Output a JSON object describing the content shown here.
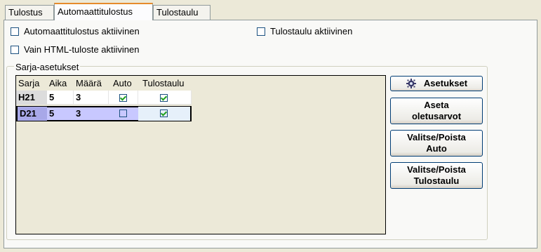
{
  "tabs": [
    {
      "label": "Tulostus",
      "active": false
    },
    {
      "label": "Automaattitulostus",
      "active": true
    },
    {
      "label": "Tulostaulu",
      "active": false
    }
  ],
  "options": {
    "auto_active_label": "Automaattitulostus aktiivinen",
    "auto_active_checked": false,
    "board_active_label": "Tulostaulu aktiivinen",
    "board_active_checked": false,
    "html_only_label": "Vain HTML-tuloste aktiivinen",
    "html_only_checked": false
  },
  "series_group": {
    "title": "Sarja-asetukset",
    "columns": [
      "Sarja",
      "Aika",
      "Määrä",
      "Auto",
      "Tulostaulu"
    ],
    "rows": [
      {
        "sarja": "H21",
        "aika": "5",
        "maara": "3",
        "auto": true,
        "tulostaulu": true,
        "selected": false
      },
      {
        "sarja": "D21",
        "aika": "5",
        "maara": "3",
        "auto": false,
        "tulostaulu": true,
        "selected": true
      }
    ]
  },
  "buttons": {
    "settings": {
      "label": "Asetukset",
      "icon": "gear-icon"
    },
    "defaults": {
      "line1": "Aseta",
      "line2": "oletusarvot"
    },
    "toggle_auto": {
      "line1": "Valitse/Poista",
      "line2": "Auto"
    },
    "toggle_board": {
      "line1": "Valitse/Poista",
      "line2": "Tulostaulu"
    }
  },
  "colors": {
    "tab_accent": "#e68b2c",
    "selected_row": "#c8c8ff",
    "check_green": "#21a121"
  }
}
